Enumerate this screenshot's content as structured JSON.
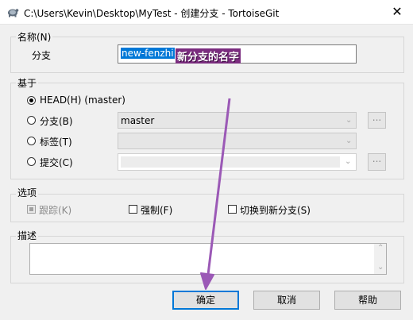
{
  "window": {
    "title": "C:\\Users\\Kevin\\Desktop\\MyTest - 创建分支 - TortoiseGit",
    "close_glyph": "✕",
    "app_icon": "tortoise-icon"
  },
  "name_section": {
    "label": "名称(N)",
    "branch_label": "分支",
    "branch_value": "new-fenzhi",
    "annotation": "新分支的名字"
  },
  "base_section": {
    "label": "基于",
    "options": [
      {
        "label": "HEAD(H) (master)",
        "checked": true
      },
      {
        "label": "分支(B)",
        "checked": false,
        "value": "master"
      },
      {
        "label": "标签(T)",
        "checked": false,
        "value": ""
      },
      {
        "label": "提交(C)",
        "checked": false,
        "value": ""
      }
    ],
    "browse_label": "..."
  },
  "options_section": {
    "label": "选项",
    "track": "跟踪(K)",
    "force": "强制(F)",
    "switch": "切换到新分支(S)"
  },
  "description_section": {
    "label": "描述",
    "value": ""
  },
  "buttons": {
    "ok": "确定",
    "cancel": "取消",
    "help": "帮助"
  },
  "colors": {
    "selection": "#0078d7",
    "annotation_arrow": "#9b59b6",
    "annotation_text": "#ffffff"
  }
}
